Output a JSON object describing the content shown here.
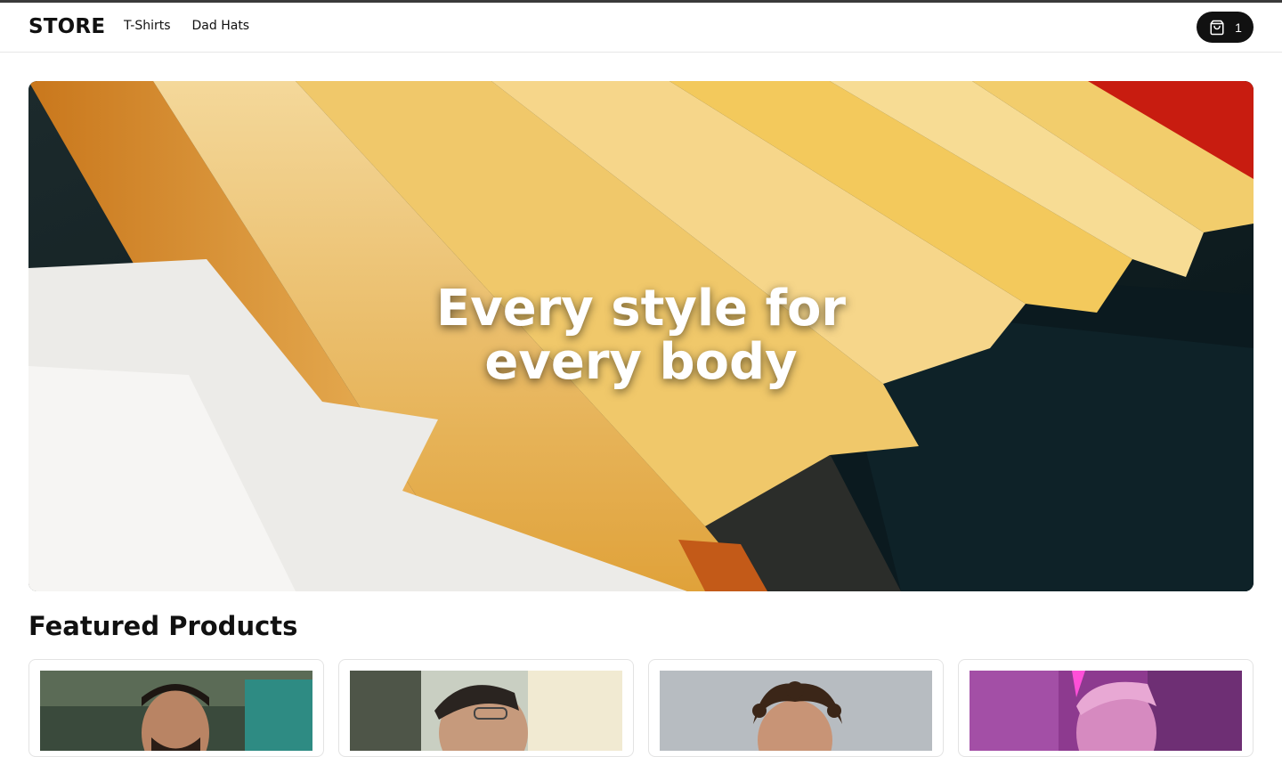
{
  "header": {
    "brand": "STORE",
    "nav": [
      {
        "label": "T-Shirts"
      },
      {
        "label": "Dad Hats"
      }
    ],
    "cart": {
      "icon": "shopping-bag-icon",
      "count": "1"
    }
  },
  "hero": {
    "title": "Every style for every body"
  },
  "featured": {
    "title": "Featured Products",
    "products": [
      {
        "image": "man-with-beard-photo"
      },
      {
        "image": "man-with-glasses-photo"
      },
      {
        "image": "curly-hair-man-photo"
      },
      {
        "image": "pink-lit-portrait-photo"
      }
    ]
  },
  "colors": {
    "accent": "#111111",
    "background": "#ffffff"
  }
}
